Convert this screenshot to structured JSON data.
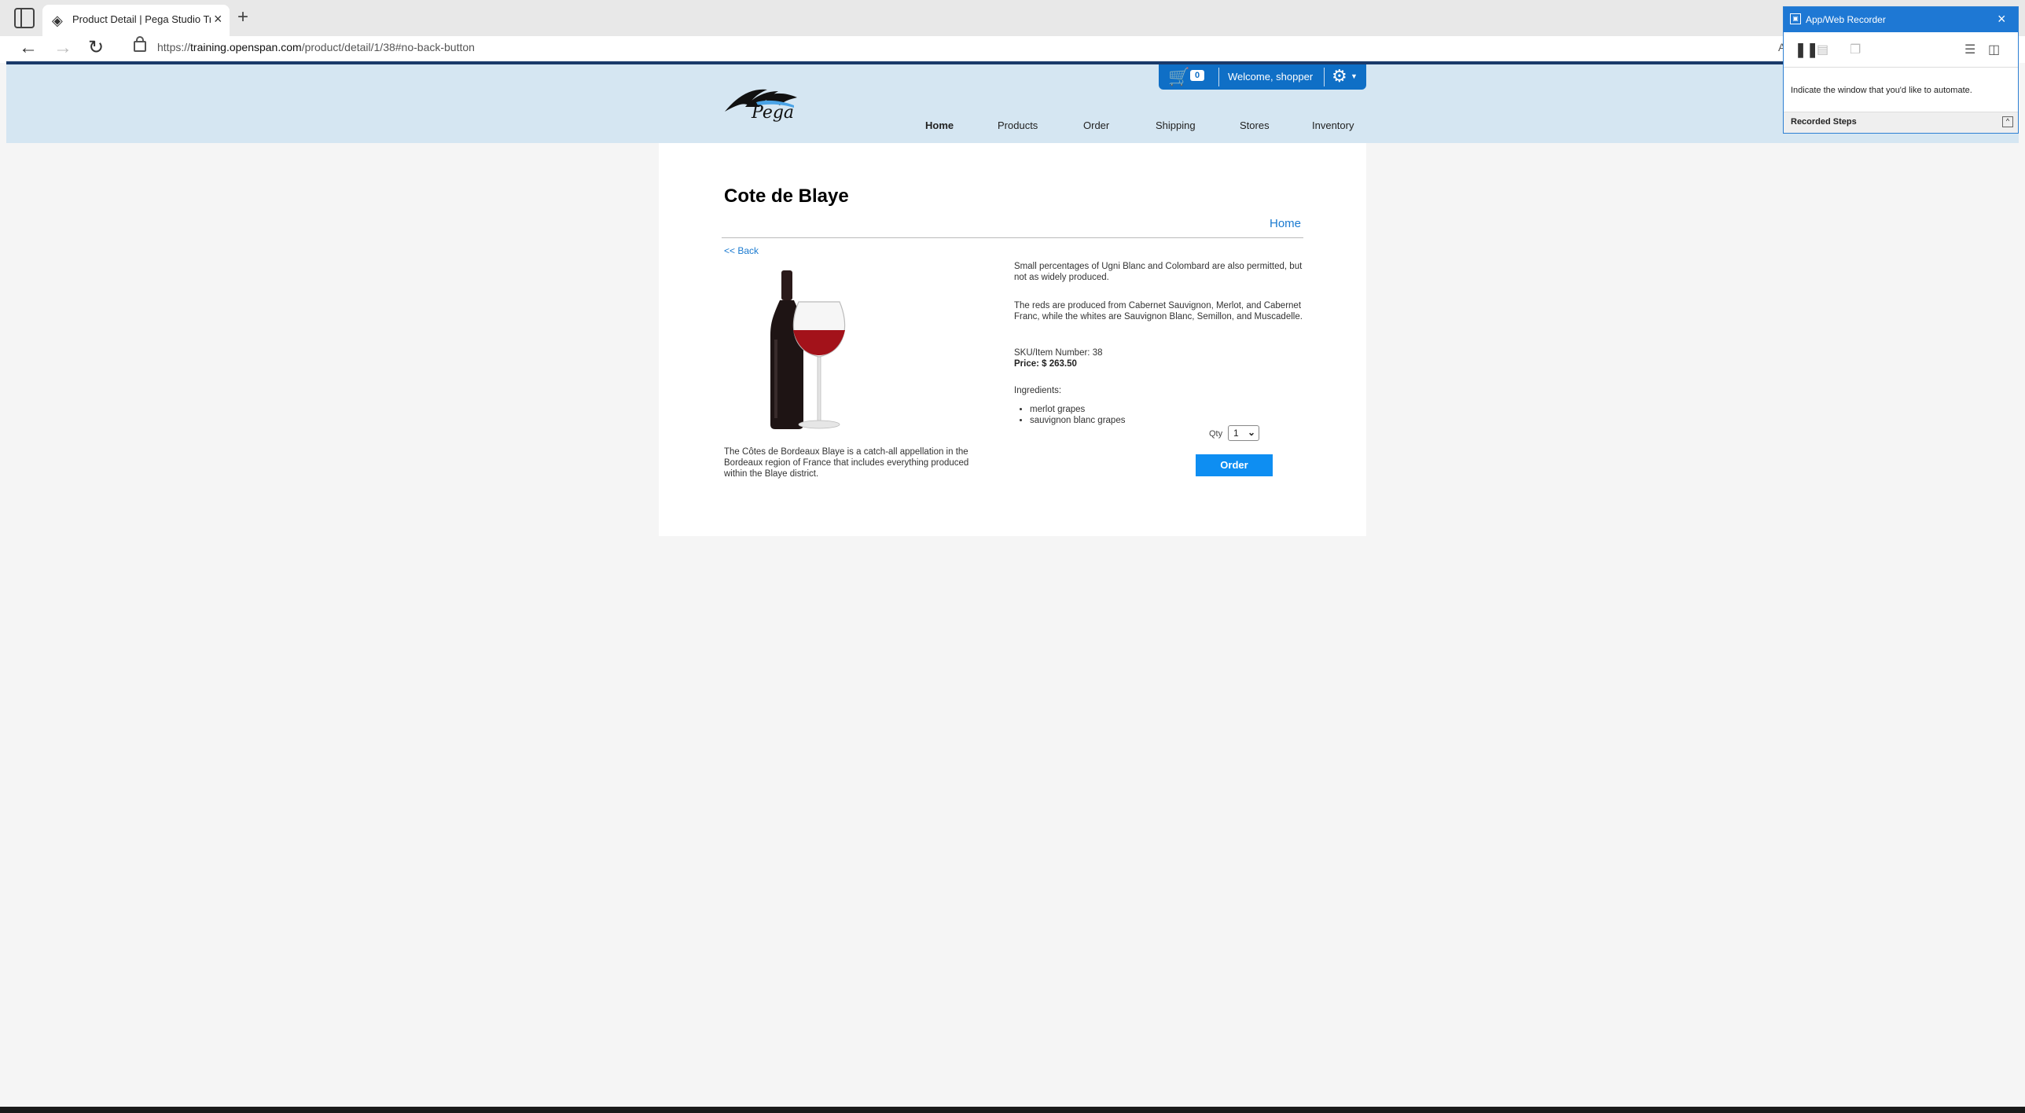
{
  "browser": {
    "tab_title": "Product Detail | Pega Studio Training",
    "url_prefix": "https://",
    "url_host": "training.openspan.com",
    "url_path": "/product/detail/1/38#no-back-button",
    "reader_icon": "A"
  },
  "site": {
    "logo_text": "Pega",
    "cart_count": "0",
    "welcome": "Welcome, shopper",
    "nav": [
      "Home",
      "Products",
      "Order",
      "Shipping",
      "Stores",
      "Inventory"
    ]
  },
  "product": {
    "title": "Cote de Blaye",
    "home_link": "Home",
    "back_link": "<< Back",
    "description_left": "The Côtes de Bordeaux Blaye is a catch-all appellation in the Bordeaux region of France that includes everything produced within the Blaye district.",
    "description_1": "Small percentages of Ugni Blanc and Colombard are also permitted, but not as widely produced.",
    "description_2": "The reds are produced from Cabernet Sauvignon, Merlot, and Cabernet Franc, while the whites are Sauvignon Blanc, Semillon, and Muscadelle.",
    "sku": "SKU/Item Number: 38",
    "price": "Price: $ 263.50",
    "ingredients_label": "Ingredients:",
    "ingredients": [
      "merlot grapes",
      "sauvignon blanc grapes"
    ],
    "qty_label": "Qty",
    "qty_value": "1",
    "order_label": "Order"
  },
  "recorder": {
    "title": "App/Web Recorder",
    "message": "Indicate the window that you'd like to automate.",
    "steps_label": "Recorded Steps"
  },
  "colors": {
    "header_bg": "#d5e6f2",
    "userbar_bg": "#0f6fc6",
    "order_button": "#0e8ef2",
    "link": "#1a7ad0",
    "recorder_titlebar": "#1e78d4"
  },
  "icons": [
    "sidebar-icon",
    "pega-favicon",
    "close-icon",
    "plus-icon",
    "back-arrow-icon",
    "forward-arrow-icon",
    "reload-icon",
    "lock-icon",
    "cart-icon",
    "gear-icon",
    "pause-icon",
    "save-icon",
    "copy-icon",
    "list-icon",
    "settings-icon",
    "chevron-up-icon"
  ]
}
